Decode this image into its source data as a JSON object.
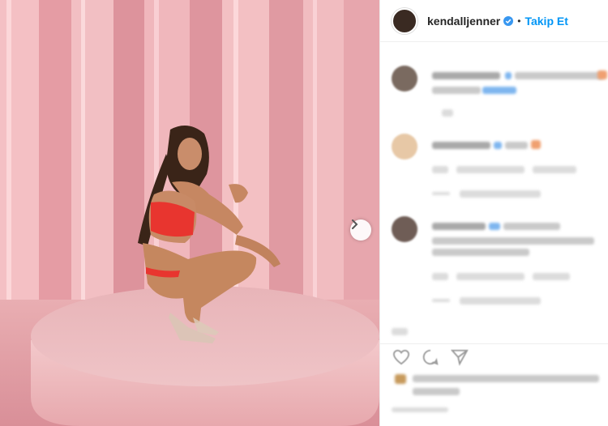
{
  "post": {
    "username": "kendalljenner",
    "separator": "•",
    "follow_label": "Takip Et",
    "next_icon": "chevron-right-icon"
  },
  "colors": {
    "accent": "#0095f6",
    "verified": "#3897f0",
    "text": "#262626",
    "backdrop": "#e9a9b0"
  }
}
